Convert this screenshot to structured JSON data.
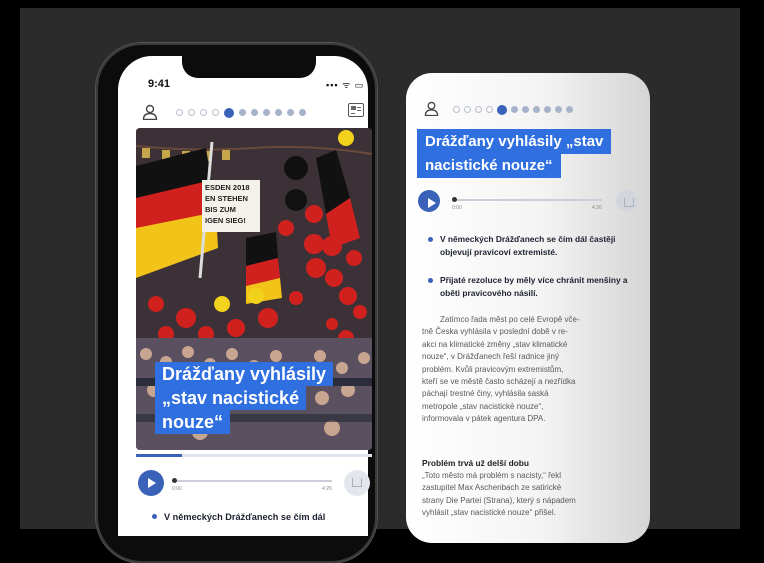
{
  "phone": {
    "status_time": "9:41",
    "status_icons": "▪▪▪ ᯤ ▭",
    "pagination": {
      "total": 11,
      "active_index": 4
    },
    "headline_lines": [
      "Drážďany vyhlásily",
      "„stav nacistické",
      "nouze“"
    ],
    "photo_sign": [
      "ESDEN 2018",
      "EN STEHEN",
      "BIS ZUM",
      "IGEN SIEG!"
    ],
    "audio": {
      "start": "0:00",
      "end": "4:26"
    },
    "bullets": [
      "V německých Drážďanech se čím dál"
    ]
  },
  "card": {
    "pagination": {
      "total": 11,
      "active_index": 4
    },
    "headline_lines": [
      "Drážďany vyhlásily „stav",
      "nacistické nouze“"
    ],
    "audio": {
      "start": "0:00",
      "end": "4:26"
    },
    "bullets": [
      "V německých Drážďanech se čím dál častěji objevují pravicoví extremisté.",
      "Přijaté rezoluce by měly více chránit menšiny a oběti pravicového násilí."
    ],
    "body_lines": [
      "Zatímco řada měst po celé Evropě vče-",
      "tně Česka vyhlásila v poslední době v re-",
      "akci na klimatické změny „stav klimatické",
      "nouze“, v Drážďanech řeší radnice jiný",
      "problém. Kvůli pravicovým extremistům,",
      "kteří se ve městě často scházejí a nezřídka",
      "páchají trestné činy, vyhlásila saská",
      "metropole „stav nacistické nouze“,",
      "informovala v pátek agentura DPA."
    ],
    "subhead": "Problém trvá už delší dobu",
    "quote_lines": [
      "„Toto město má problém s nacisty,“ řekl",
      "zastupitel Max Aschenbach ze satirické",
      "strany Die Partei (Strana), který s nápadem",
      "vyhlásit „stav nacistické nouze“ přišel."
    ]
  },
  "colors": {
    "accent": "#2f6fe0",
    "pagination_active": "#3a62b8",
    "background": "#2b2b2b"
  }
}
